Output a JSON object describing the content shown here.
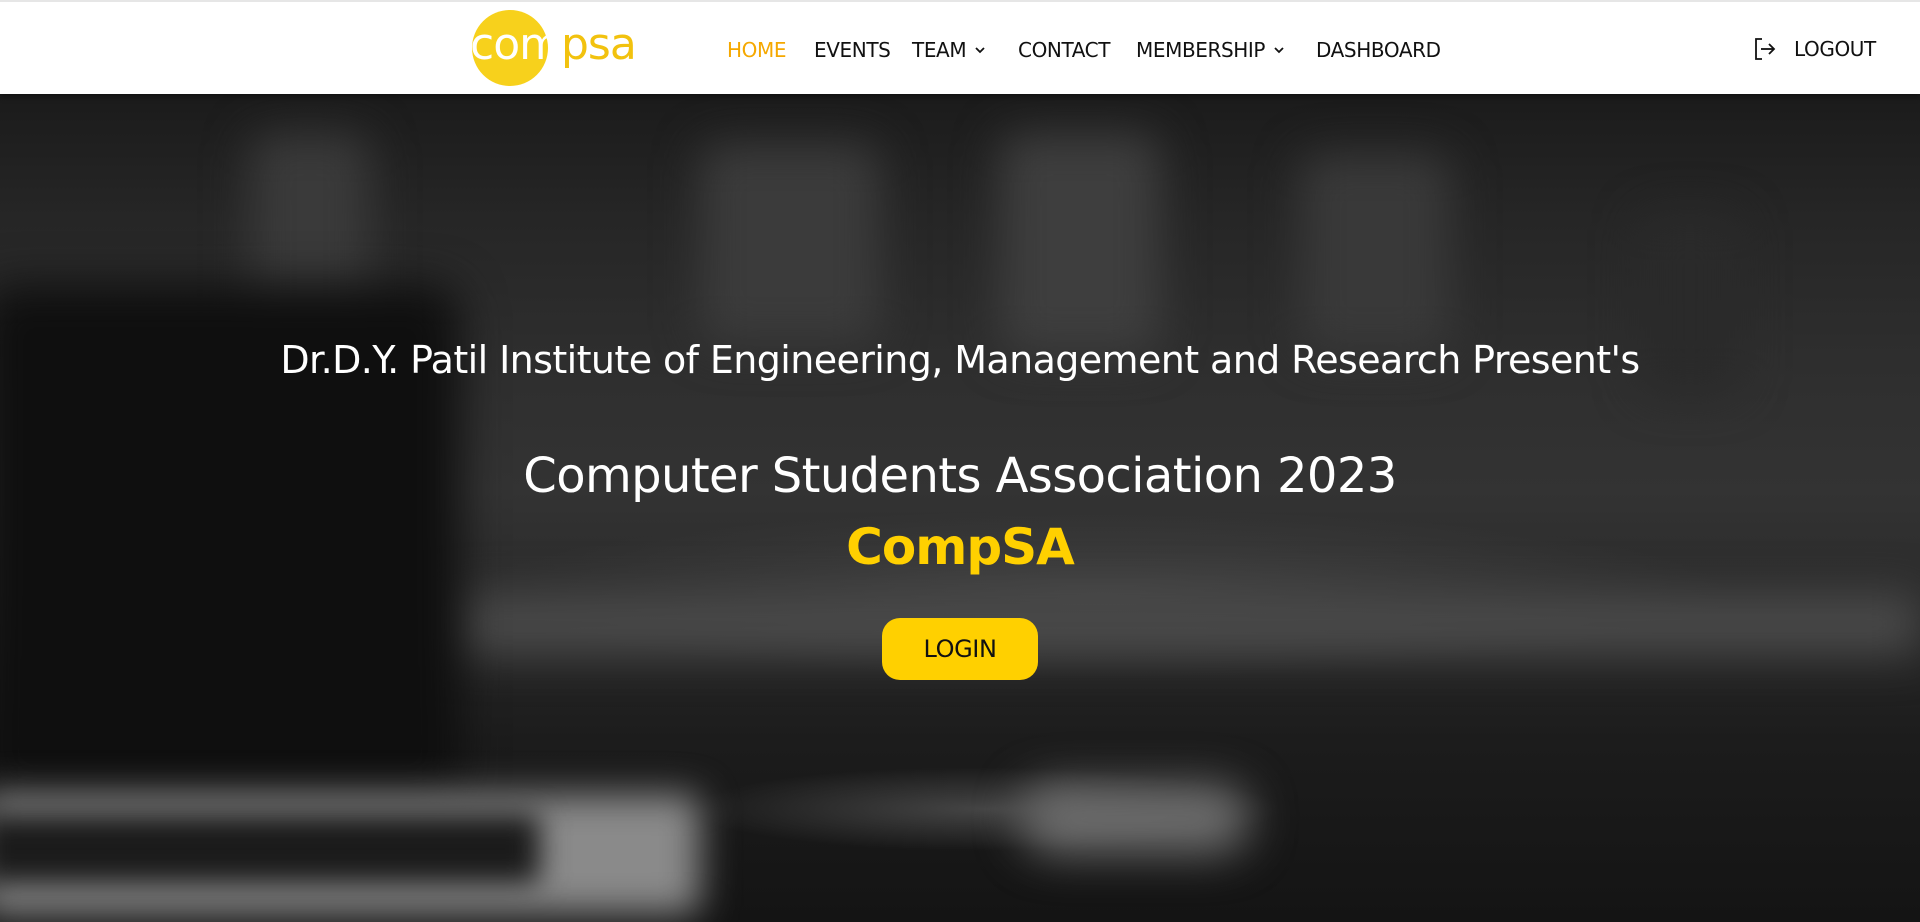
{
  "navbar": {
    "logo": {
      "text_inside": "com",
      "text_outside": "psa"
    },
    "items": [
      {
        "label": "HOME",
        "active": true
      },
      {
        "label": "EVENTS",
        "active": false
      },
      {
        "label": "TEAM",
        "active": false,
        "dropdown": true
      },
      {
        "label": "CONTACT",
        "active": false
      },
      {
        "label": "MEMBERSHIP",
        "active": false,
        "dropdown": true
      },
      {
        "label": "DASHBOARD",
        "active": false
      }
    ],
    "logout_label": "LOGOUT",
    "logout_icon": "logout-icon"
  },
  "hero": {
    "subtitle": "Dr.D.Y. Patil Institute of Engineering, Management and Research Present's",
    "title": "Computer Students Association 2023",
    "brand": "CompSA",
    "login_label": "LOGIN"
  },
  "colors": {
    "accent": "#ffd000",
    "active_nav": "#f5a800",
    "logo_yellow": "#f7d11c",
    "navbar_bg": "#ffffff",
    "hero_text": "#ffffff"
  }
}
